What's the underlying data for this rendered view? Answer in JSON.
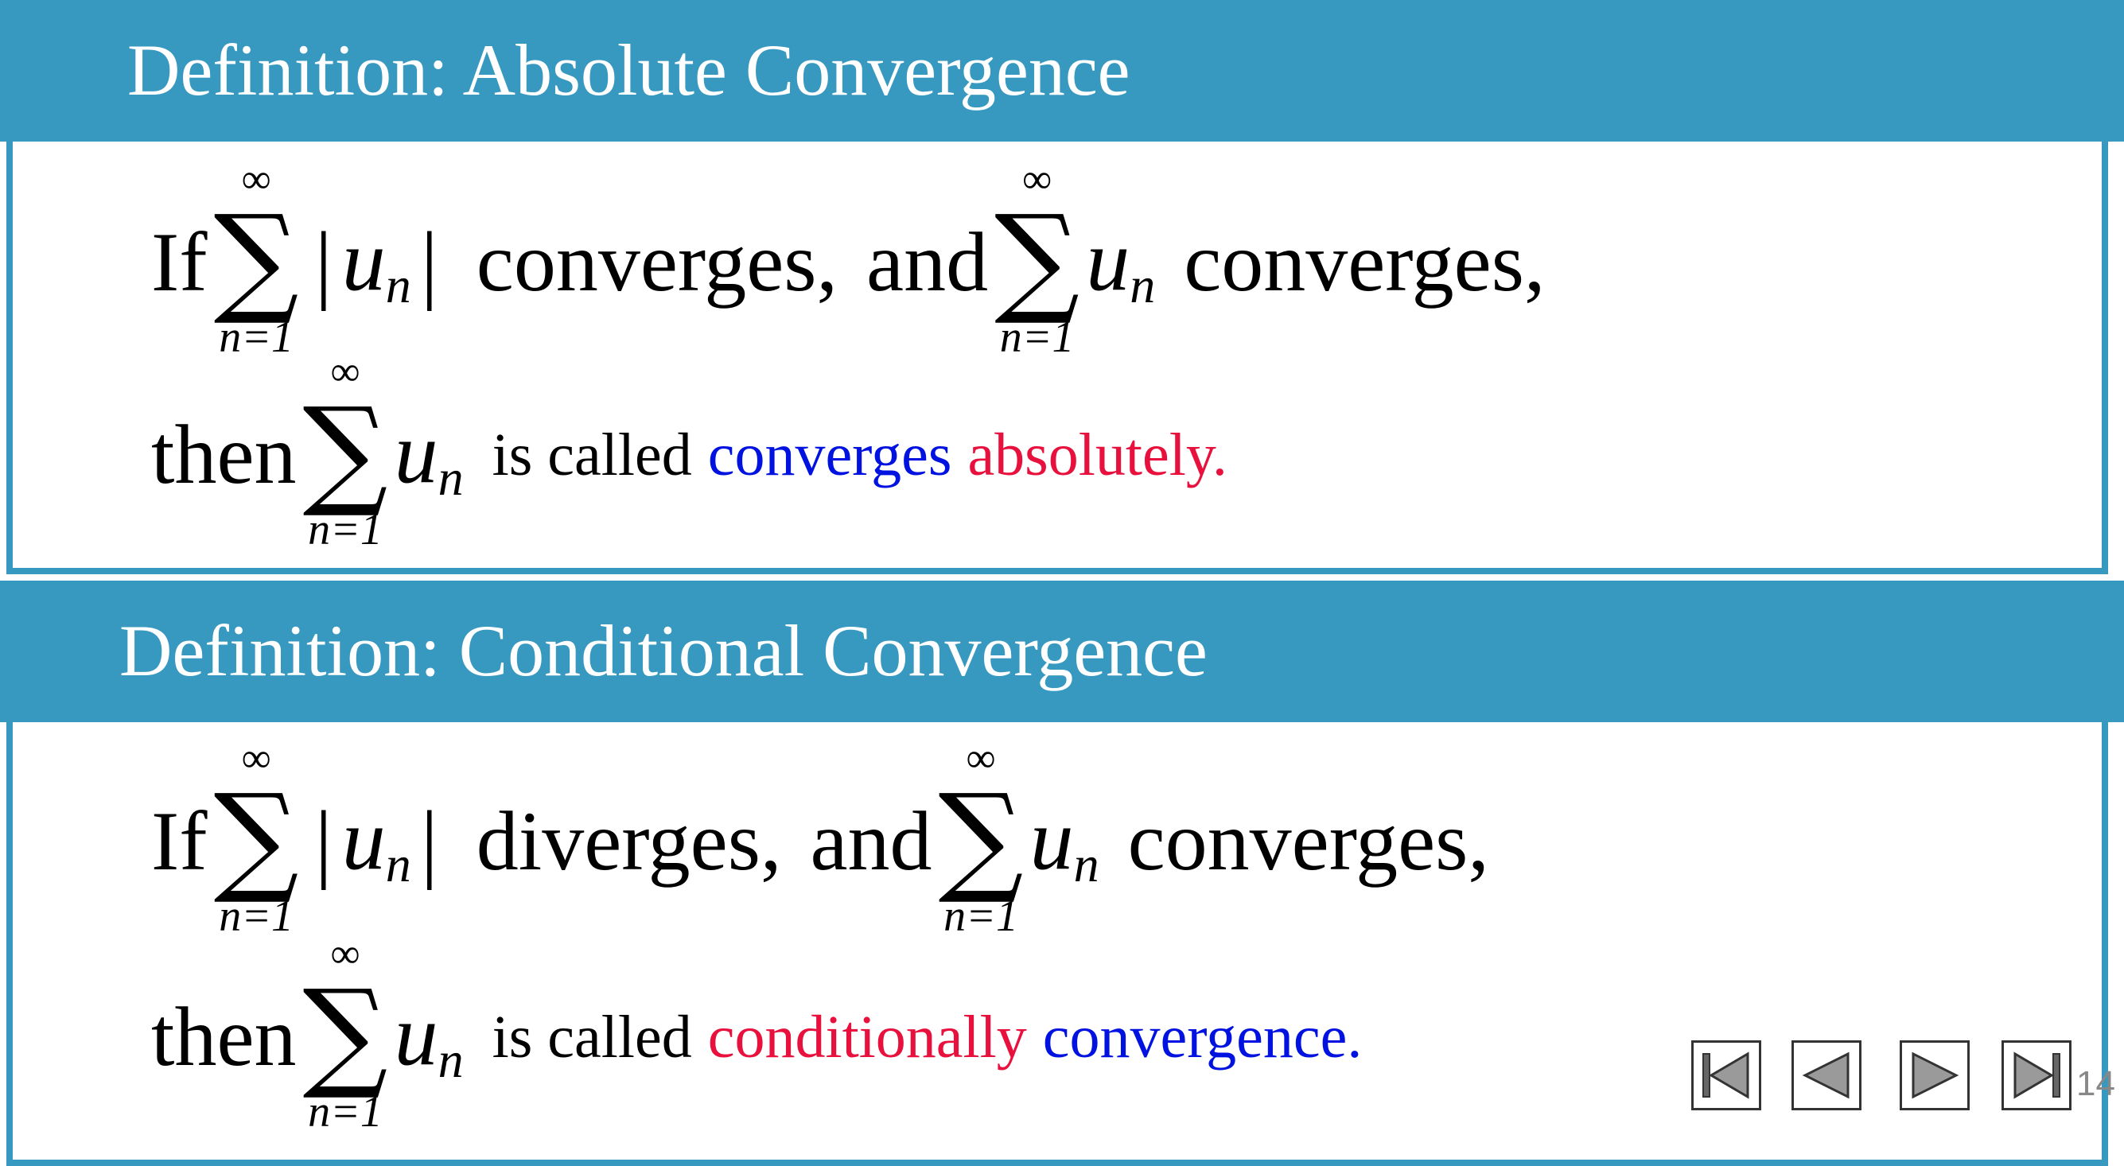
{
  "absolute": {
    "title": "Definition: Absolute Convergence",
    "line1": {
      "if": "If",
      "sum_upper": "∞",
      "sum_symbol": "∑",
      "sum_lower": "n=1",
      "var": "u",
      "subscript": "n",
      "bar": "|",
      "text1": "converges,",
      "and": "and",
      "text2": "converges,"
    },
    "line2": {
      "then": "then",
      "is_called": "is called",
      "term_a": "converges",
      "term_b": "absolutely."
    }
  },
  "conditional": {
    "title": "Definition: Conditional Convergence",
    "line1": {
      "if": "If",
      "text1": "diverges,",
      "and": "and",
      "text2": "converges,"
    },
    "line2": {
      "then": "then",
      "is_called": "is called",
      "term_a": "conditionally",
      "term_b": "convergence."
    }
  },
  "nav": {
    "page_number": "14",
    "buttons": [
      "first-page",
      "previous-page",
      "next-page",
      "last-page"
    ]
  },
  "colors": {
    "header_bg": "#3899c0",
    "blue_term": "#0012e0",
    "red_term": "#e8103c"
  }
}
